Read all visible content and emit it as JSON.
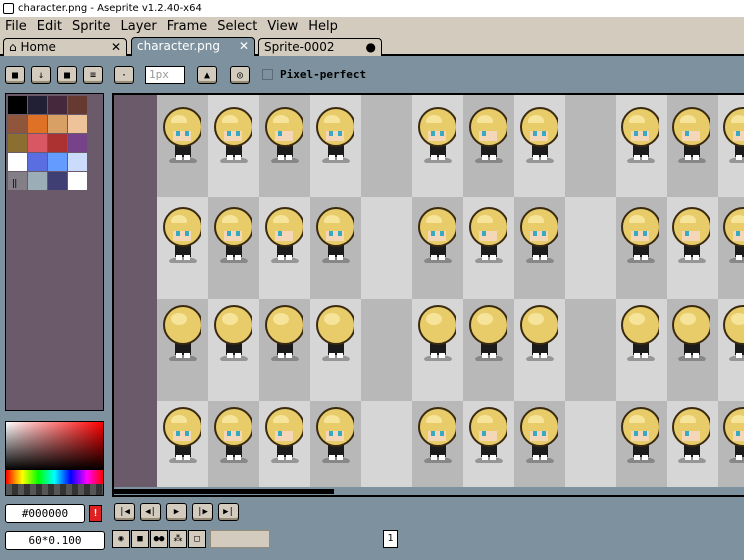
{
  "window": {
    "title": "character.png - Aseprite v1.2.40-x64"
  },
  "menu": [
    "File",
    "Edit",
    "Sprite",
    "Layer",
    "Frame",
    "Select",
    "View",
    "Help"
  ],
  "tabs": {
    "home": {
      "label": "Home",
      "close": "✕"
    },
    "active": {
      "label": "character.png",
      "close": "✕"
    },
    "sprite": {
      "label": "Sprite-0002",
      "modified": "●"
    }
  },
  "toolbar": {
    "brush_size_placeholder": "1px",
    "pixel_perfect_label": "Pixel-perfect",
    "pixel_perfect_checked": false
  },
  "palette": {
    "colors": [
      "#000000",
      "#222034",
      "#45283c",
      "#663931",
      "#8f563b",
      "#df7126",
      "#d9a066",
      "#eec39a",
      "#8a6f30",
      "#d95763",
      "#ac3232",
      "#76428a",
      "#ffffff",
      "#5b6ee1",
      "#639bff",
      "#cbdbfc",
      "#847e87",
      "#9badb7",
      "#3f3f74",
      "#ffffff"
    ]
  },
  "color": {
    "hex": "#000000",
    "warning": "!"
  },
  "status": {
    "zoom": "60*0.100"
  },
  "timeline": {
    "frame_number": "1"
  },
  "colors": {
    "bg": "#7d929e",
    "chrome": "#d3cbbe",
    "editor_bg": "#6a5a6a"
  }
}
